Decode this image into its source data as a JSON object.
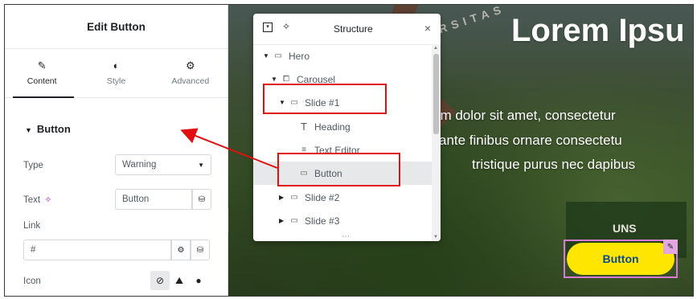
{
  "panel": {
    "title": "Edit Button",
    "tabs": [
      {
        "label": "Content",
        "icon": "pencil-icon"
      },
      {
        "label": "Style",
        "icon": "contrast-icon"
      },
      {
        "label": "Advanced",
        "icon": "gear-icon"
      }
    ],
    "section_title": "Button",
    "type_label": "Type",
    "type_value": "Warning",
    "text_label": "Text",
    "text_value": "Button",
    "link_label": "Link",
    "link_value": "#",
    "icon_label": "Icon"
  },
  "structure": {
    "title": "Structure",
    "items": [
      {
        "label": "Hero",
        "icon": "container-icon"
      },
      {
        "label": "Carousel",
        "icon": "carousel-icon"
      },
      {
        "label": "Slide #1",
        "icon": "container-icon"
      },
      {
        "label": "Heading",
        "icon": "heading-icon"
      },
      {
        "label": "Text Editor",
        "icon": "text-editor-icon"
      },
      {
        "label": "Button",
        "icon": "button-icon"
      },
      {
        "label": "Slide #2",
        "icon": "container-icon"
      },
      {
        "label": "Slide #3",
        "icon": "container-icon"
      }
    ]
  },
  "preview": {
    "title": "Lorem Ipsu",
    "lines": [
      "um dolor sit amet, consectetur",
      "ante finibus ornare consectetu",
      "tristique purus nec dapibus"
    ],
    "button_label": "Button",
    "sign_text": "UNS",
    "arch_text": "VERSITAS"
  },
  "colors": {
    "button_bg": "#ffe600",
    "button_text": "#0b4a8f",
    "highlight": "#e01010",
    "selection_outline": "#d77bd5"
  }
}
